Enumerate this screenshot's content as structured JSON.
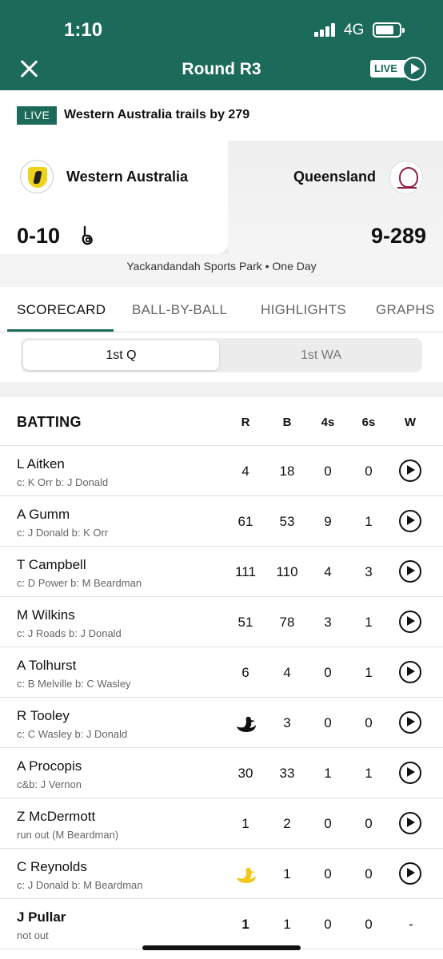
{
  "status_bar": {
    "time": "1:10",
    "network": "4G"
  },
  "header": {
    "title": "Round R3",
    "live_label": "LIVE"
  },
  "banner": {
    "badge": "LIVE",
    "text": "Western Australia trails by 279"
  },
  "match": {
    "home": {
      "name": "Western Australia",
      "score": "0-10"
    },
    "away": {
      "name": "Queensland",
      "score": "9-289"
    },
    "venue": "Yackandandah Sports Park • One Day"
  },
  "tabs": [
    {
      "label": "SCORECARD"
    },
    {
      "label": "BALL-BY-BALL"
    },
    {
      "label": "HIGHLIGHTS"
    },
    {
      "label": "GRAPHS"
    }
  ],
  "innings_toggle": {
    "options": [
      "1st Q",
      "1st WA"
    ],
    "selected": "1st Q"
  },
  "batting": {
    "heading": "BATTING",
    "columns": [
      "R",
      "B",
      "4s",
      "6s",
      "W"
    ],
    "rows": [
      {
        "name": "L Aitken",
        "dismissal": "c: K Orr b: J Donald",
        "r": "4",
        "b": "18",
        "fours": "0",
        "sixes": "0"
      },
      {
        "name": "A Gumm",
        "dismissal": "c: J Donald b: K Orr",
        "r": "61",
        "b": "53",
        "fours": "9",
        "sixes": "1"
      },
      {
        "name": "T Campbell",
        "dismissal": "c: D Power b: M Beardman",
        "r": "111",
        "b": "110",
        "fours": "4",
        "sixes": "3"
      },
      {
        "name": "M Wilkins",
        "dismissal": "c: J Roads b: J Donald",
        "r": "51",
        "b": "78",
        "fours": "3",
        "sixes": "1"
      },
      {
        "name": "A Tolhurst",
        "dismissal": "c: B Melville b: C Wasley",
        "r": "6",
        "b": "4",
        "fours": "0",
        "sixes": "1"
      },
      {
        "name": "R Tooley",
        "dismissal": "c: C Wasley b: J Donald",
        "r": "",
        "b": "3",
        "fours": "0",
        "sixes": "0",
        "duck": "black"
      },
      {
        "name": "A Procopis",
        "dismissal": "c&b: J Vernon",
        "r": "30",
        "b": "33",
        "fours": "1",
        "sixes": "1"
      },
      {
        "name": "Z McDermott",
        "dismissal": "run out (M Beardman)",
        "r": "1",
        "b": "2",
        "fours": "0",
        "sixes": "0"
      },
      {
        "name": "C Reynolds",
        "dismissal": "c: J Donald b: M Beardman",
        "r": "",
        "b": "1",
        "fours": "0",
        "sixes": "0",
        "duck": "gold"
      },
      {
        "name": "J Pullar",
        "dismissal": "not out",
        "r": "1",
        "b": "1",
        "fours": "0",
        "sixes": "0",
        "not_out": true,
        "w": "-"
      }
    ]
  },
  "colors": {
    "brand": "#1c6b5a",
    "duck_gold": "#f2c81b",
    "duck_black": "#111111"
  },
  "icons": [
    "close-icon",
    "live-play-icon",
    "bat-icon",
    "play-icon",
    "duck-icon",
    "signal-icon",
    "battery-icon"
  ]
}
